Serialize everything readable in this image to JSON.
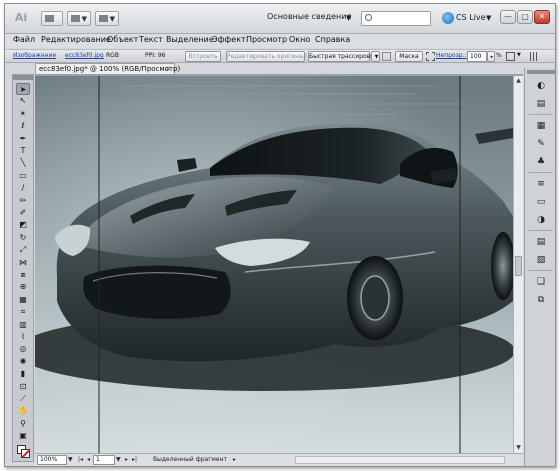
{
  "app": {
    "logo": "Ai",
    "workspace": "Основные сведения",
    "cs_live": "CS Live",
    "window_buttons": [
      "—",
      "▢",
      "✕"
    ]
  },
  "search": {
    "placeholder": ""
  },
  "menu": [
    "Файл",
    "Редактирование",
    "Объект",
    "Текст",
    "Выделение",
    "Эффект",
    "Просмотр",
    "Окно",
    "Справка"
  ],
  "control_panel": {
    "image_link": "Изображение",
    "file_link": "ecc83ef0.jpg",
    "color_mode": "RGB",
    "ppi": "PPI: 96",
    "embed_button": "Встроить",
    "edit_original_button": "Редактировать оригинал",
    "live_trace_button": "Быстрая трассировка",
    "mask_button": "Маска",
    "opacity_link": "Непрозр.:",
    "opacity_value": "100",
    "opacity_unit": "%"
  },
  "document": {
    "tab_title": "ecc83ef0.jpg* @ 100% (RGB/Просмотр)",
    "tab_close": "✕"
  },
  "status": {
    "zoom": "100%",
    "page": "1",
    "selection_text": "Выделенный фрагмент"
  },
  "tools": [
    {
      "icon": "selection-arrow-icon",
      "glyph": "➤"
    },
    {
      "icon": "direct-selection-icon",
      "glyph": "↖"
    },
    {
      "icon": "magic-wand-icon",
      "glyph": "✴"
    },
    {
      "icon": "lasso-icon",
      "glyph": "ℓ"
    },
    {
      "icon": "pen-icon",
      "glyph": "✒"
    },
    {
      "icon": "type-icon",
      "glyph": "T"
    },
    {
      "icon": "line-segment-icon",
      "glyph": "╲"
    },
    {
      "icon": "rectangle-icon",
      "glyph": "▭"
    },
    {
      "icon": "paintbrush-icon",
      "glyph": "∕"
    },
    {
      "icon": "pencil-icon",
      "glyph": "✏"
    },
    {
      "icon": "blob-brush-icon",
      "glyph": "✐"
    },
    {
      "icon": "eraser-icon",
      "glyph": "◩"
    },
    {
      "icon": "rotate-icon",
      "glyph": "↻"
    },
    {
      "icon": "scale-icon",
      "glyph": "⤢"
    },
    {
      "icon": "width-tool-icon",
      "glyph": "⋈"
    },
    {
      "icon": "free-transform-icon",
      "glyph": "⧈"
    },
    {
      "icon": "shape-builder-icon",
      "glyph": "⊕"
    },
    {
      "icon": "perspective-grid-icon",
      "glyph": "▦"
    },
    {
      "icon": "mesh-icon",
      "glyph": "⌗"
    },
    {
      "icon": "gradient-icon",
      "glyph": "▥"
    },
    {
      "icon": "eyedropper-icon",
      "glyph": "⌇"
    },
    {
      "icon": "blend-icon",
      "glyph": "◎"
    },
    {
      "icon": "symbol-sprayer-icon",
      "glyph": "✺"
    },
    {
      "icon": "column-graph-icon",
      "glyph": "▮"
    },
    {
      "icon": "artboard-icon",
      "glyph": "⊡"
    },
    {
      "icon": "slice-icon",
      "glyph": "⟋"
    },
    {
      "icon": "hand-icon",
      "glyph": "✋"
    },
    {
      "icon": "zoom-icon",
      "glyph": "⚲"
    },
    {
      "icon": "screen-mode-icon",
      "glyph": "▣"
    }
  ],
  "dock_icons": [
    {
      "icon": "color-panel-icon",
      "glyph": "◐"
    },
    {
      "icon": "color-guide-icon",
      "glyph": "▤"
    },
    {
      "icon": "swatches-icon",
      "glyph": "▦"
    },
    {
      "icon": "brushes-icon",
      "glyph": "✎"
    },
    {
      "icon": "symbols-icon",
      "glyph": "♣"
    },
    {
      "icon": "stroke-icon",
      "glyph": "≡"
    },
    {
      "icon": "gradient-panel-icon",
      "glyph": "▭"
    },
    {
      "icon": "transparency-icon",
      "glyph": "◑"
    },
    {
      "icon": "appearance-icon",
      "glyph": "▤"
    },
    {
      "icon": "graphic-styles-icon",
      "glyph": "▧"
    },
    {
      "icon": "layers-icon",
      "glyph": "❏"
    },
    {
      "icon": "artboards-icon",
      "glyph": "⧉"
    }
  ],
  "colors": {
    "link": "#1b3fb5",
    "close_button": "#c0392b",
    "canvas_bg": "#5f6d72"
  }
}
